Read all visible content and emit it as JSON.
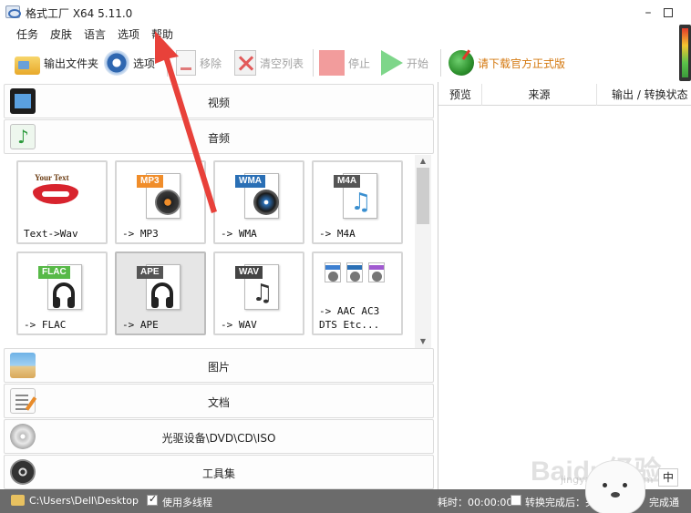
{
  "window": {
    "title": "格式工厂 X64 5.11.0",
    "minimize": "–"
  },
  "menu": [
    "任务",
    "皮肤",
    "语言",
    "选项",
    "帮助"
  ],
  "toolbar": {
    "output_folder": "输出文件夹",
    "options": "选项",
    "remove": "移除",
    "clear_list": "清空列表",
    "stop": "停止",
    "start": "开始",
    "download_official": "请下载官方正式版"
  },
  "categories": {
    "video": "视频",
    "audio": "音频",
    "picture": "图片",
    "document": "文档",
    "optical": "光驱设备\\DVD\\CD\\ISO",
    "tools": "工具集"
  },
  "audio_formats": [
    {
      "badge": "",
      "label": "Text->Wav",
      "art": "Your Text"
    },
    {
      "badge": "MP3",
      "label": "-> MP3"
    },
    {
      "badge": "WMA",
      "label": "-> WMA"
    },
    {
      "badge": "M4A",
      "label": "-> M4A"
    },
    {
      "badge": "FLAC",
      "label": "-> FLAC"
    },
    {
      "badge": "APE",
      "label": "-> APE"
    },
    {
      "badge": "WAV",
      "label": "-> WAV"
    },
    {
      "badge": "",
      "label": "-> AAC AC3\nDTS Etc..."
    }
  ],
  "task_list": {
    "columns": [
      "预览",
      "来源",
      "输出 / 转换状态"
    ]
  },
  "statusbar": {
    "path": "C:\\Users\\Dell\\Desktop",
    "multithread": "使用多线程",
    "elapsed": "耗时：00:00:00",
    "after_done": "转换完成后：关",
    "notify": "完成通"
  },
  "overlay": {
    "ime": "中",
    "watermark": "Baidu经验",
    "watermark_sub": "jingyan.baidu.com"
  },
  "colors": {
    "promo": "#d4780f",
    "arrow": "#e8413a",
    "mp3": "#f08d2a",
    "wma": "#2a6fb5",
    "m4a": "#555555",
    "flac": "#57b947",
    "ape": "#555555",
    "wav": "#444444"
  }
}
